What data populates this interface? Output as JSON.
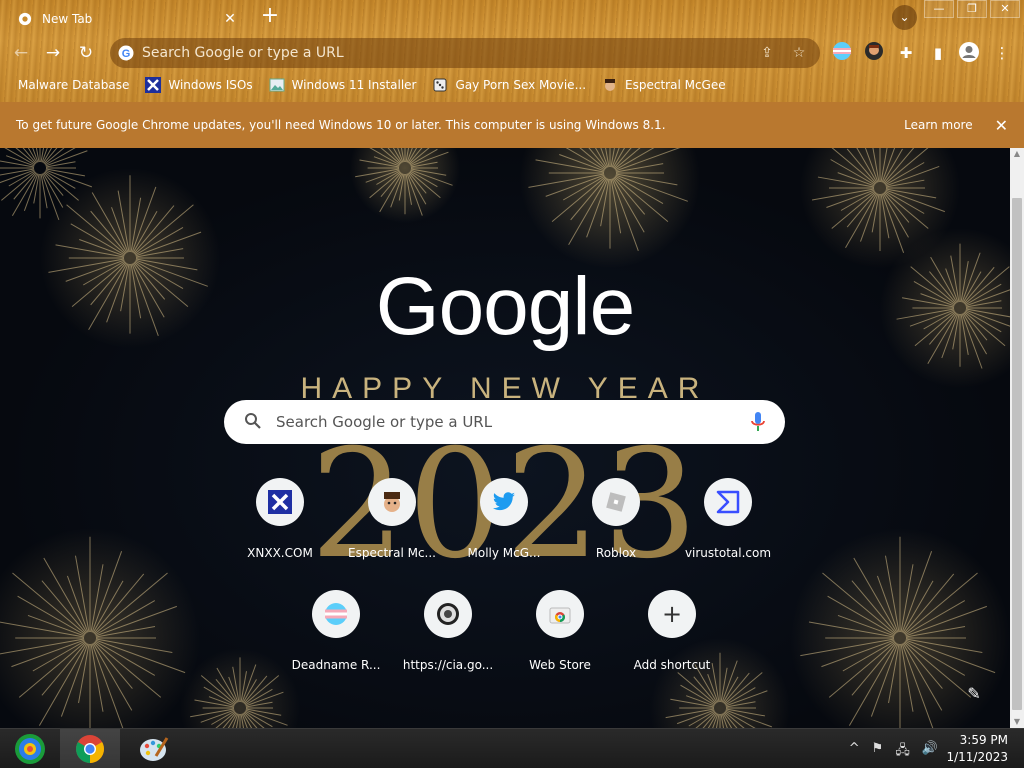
{
  "window": {
    "tab_title": "New Tab",
    "tab_close": "✕",
    "new_tab": "+",
    "tab_search": "⌄",
    "controls": {
      "minimize": "—",
      "maximize": "❐",
      "close": "✕"
    }
  },
  "toolbar": {
    "omnibox_placeholder": "Search Google or type a URL",
    "back": "←",
    "forward": "→",
    "reload": "↻"
  },
  "bookmarks": [
    {
      "label": "Malware Database",
      "icon": "blank"
    },
    {
      "label": "Windows ISOs",
      "icon": "x-icon"
    },
    {
      "label": "Windows 11 Installer",
      "icon": "image-icon"
    },
    {
      "label": "Gay Porn Sex Movie...",
      "icon": "dice-icon"
    },
    {
      "label": "Espectral McGee",
      "icon": "avatar-icon"
    }
  ],
  "infobar": {
    "message": "To get future Google Chrome updates, you'll need Windows 10 or later. This computer is using Windows 8.1.",
    "learn_more": "Learn more",
    "close": "✕"
  },
  "ntp": {
    "logo": "Google",
    "background_line1": "HAPPY NEW YEAR",
    "background_year": "2023",
    "search_placeholder": "Search Google or type a URL",
    "shortcuts": [
      {
        "label": "XNXX.COM",
        "icon": "xnxx-icon"
      },
      {
        "label": "Espectral Mc...",
        "icon": "avatar-icon"
      },
      {
        "label": "Molly McG...",
        "icon": "twitter-icon"
      },
      {
        "label": "Roblox",
        "icon": "roblox-icon"
      },
      {
        "label": "virustotal.com",
        "icon": "virustotal-icon"
      },
      {
        "label": "Deadname R...",
        "icon": "trans-flag-icon"
      },
      {
        "label": "https://cia.go...",
        "icon": "cia-seal-icon"
      },
      {
        "label": "Web Store",
        "icon": "webstore-icon"
      },
      {
        "label": "Add shortcut",
        "icon": "plus-icon"
      }
    ],
    "edit": "✎"
  },
  "taskbar": {
    "time": "3:59 PM",
    "date": "1/11/2023",
    "tray_arrow": "^"
  },
  "colors": {
    "theme_wood": "#c88a2c",
    "infobar": "#b9782f",
    "year_gold": "#a88a4c"
  }
}
